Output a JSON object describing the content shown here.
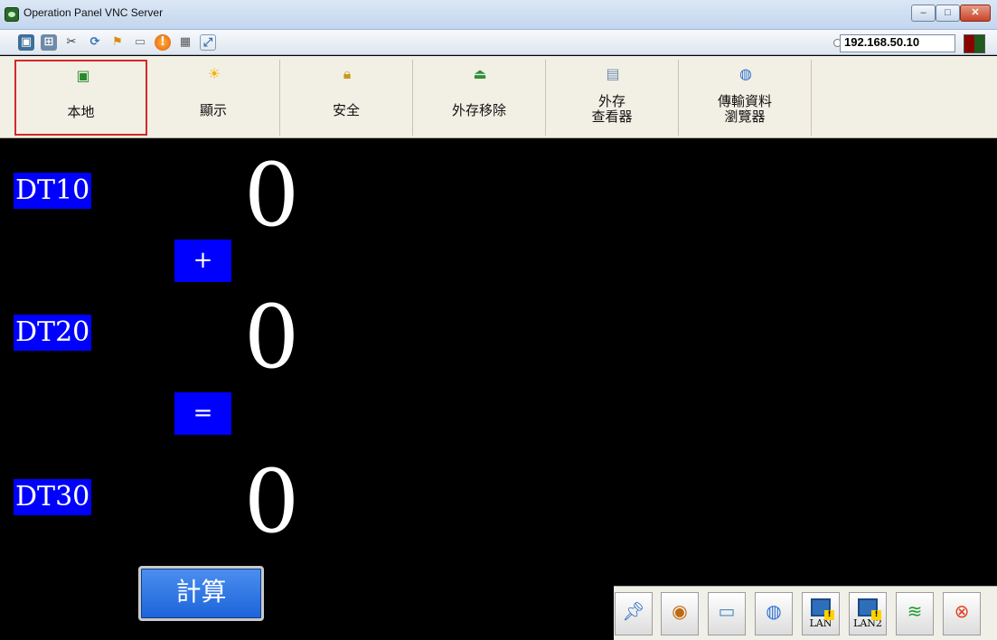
{
  "window": {
    "title": "Operation Panel VNC Server",
    "buttons": {
      "minimize": "–",
      "maximize": "□",
      "close": "✕"
    }
  },
  "toolbar": {
    "icons": [
      "monitor-icon",
      "tree-icon",
      "tools-icon",
      "refresh-icon",
      "windows-icon",
      "drive-icon",
      "alert-icon",
      "network-delete-icon",
      "fullscreen-icon"
    ],
    "address": "192.168.50.10"
  },
  "tabs": [
    {
      "label": "本地",
      "icon": "local-screen-icon",
      "active": true
    },
    {
      "label": "顯示",
      "icon": "sun-icon",
      "active": false
    },
    {
      "label": "安全",
      "icon": "lock-icon",
      "active": false
    },
    {
      "label": "外存移除",
      "icon": "eject-storage-icon",
      "active": false
    },
    {
      "label": "外存\n查看器",
      "icon": "folder-icon",
      "active": false
    },
    {
      "label": "傳輸資料\n瀏覽器",
      "icon": "globe-icon",
      "active": false
    }
  ],
  "panel": {
    "dt10": {
      "label": "DT10",
      "value": "0"
    },
    "plus": "+",
    "dt20": {
      "label": "DT20",
      "value": "0"
    },
    "equals": "=",
    "dt30": {
      "label": "DT30",
      "value": "0"
    },
    "calculate": "計算"
  },
  "tray": {
    "items": [
      "pin-icon",
      "media-icon",
      "computer-icon",
      "globe-icon",
      "lan-icon",
      "lan2-icon",
      "wifi-icon",
      "close-circle-icon"
    ],
    "lan": "LAN",
    "lan2": "LAN2"
  },
  "colors": {
    "label_bg": "#0000ff",
    "background": "#000000",
    "active_tab_border": "#d22a2a"
  }
}
